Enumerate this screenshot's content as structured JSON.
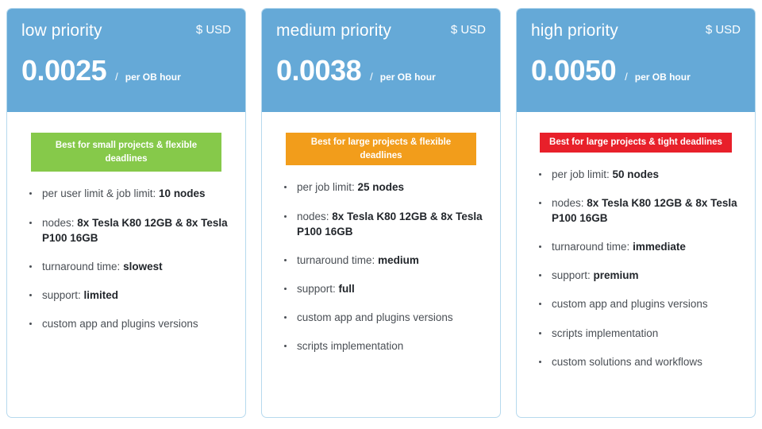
{
  "cards": [
    {
      "title": "low priority",
      "currency": "$ USD",
      "price": "0.0025",
      "slash": "/",
      "unit": "per OB hour",
      "badge": {
        "text": "Best for small projects & flexible deadlines",
        "color": "#86c94a",
        "style": "green"
      },
      "features": [
        {
          "label": "per user limit & job limit: ",
          "value": "10 nodes"
        },
        {
          "label": "nodes: ",
          "value": "8x Tesla K80 12GB & 8x Tesla P100 16GB"
        },
        {
          "label": "turnaround time: ",
          "value": "slowest"
        },
        {
          "label": "support: ",
          "value": "limited"
        },
        {
          "label": "custom app and plugins versions",
          "value": ""
        }
      ]
    },
    {
      "title": "medium priority",
      "currency": "$ USD",
      "price": "0.0038",
      "slash": "/",
      "unit": "per OB hour",
      "badge": {
        "text": "Best for large projects & flexible deadlines",
        "color": "#f29d1b",
        "style": "orange"
      },
      "features": [
        {
          "label": "per job limit: ",
          "value": "25 nodes"
        },
        {
          "label": "nodes: ",
          "value": "8x Tesla K80 12GB & 8x Tesla P100 16GB"
        },
        {
          "label": "turnaround time: ",
          "value": "medium"
        },
        {
          "label": "support: ",
          "value": "full"
        },
        {
          "label": "custom app and plugins versions",
          "value": ""
        },
        {
          "label": "scripts implementation",
          "value": ""
        }
      ]
    },
    {
      "title": "high priority",
      "currency": "$ USD",
      "price": "0.0050",
      "slash": "/",
      "unit": "per OB hour",
      "badge": {
        "text": "Best for large projects & tight deadlines",
        "color": "#e8202a",
        "style": "red"
      },
      "features": [
        {
          "label": "per job limit: ",
          "value": "50 nodes"
        },
        {
          "label": "nodes: ",
          "value": "8x Tesla K80 12GB & 8x Tesla P100 16GB"
        },
        {
          "label": "turnaround time: ",
          "value": "immediate"
        },
        {
          "label": "support: ",
          "value": "premium"
        },
        {
          "label": "custom app and plugins versions",
          "value": ""
        },
        {
          "label": "scripts implementation",
          "value": ""
        },
        {
          "label": "custom solutions and workflows",
          "value": ""
        }
      ]
    }
  ],
  "theme": {
    "header_blue": "#65a9d7",
    "border_blue": "#b6d9ee",
    "text_dark": "#22262b",
    "text_body": "#4a4f55"
  }
}
